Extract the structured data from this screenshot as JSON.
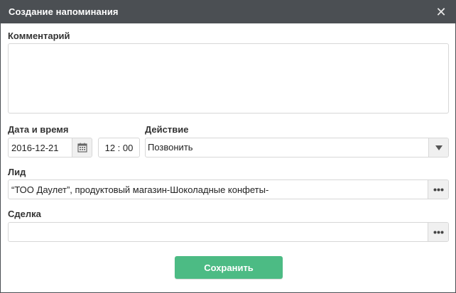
{
  "dialog": {
    "title": "Создание напоминания",
    "close_symbol": "✕"
  },
  "comment": {
    "label": "Комментарий",
    "value": ""
  },
  "datetime": {
    "label": "Дата и время",
    "date": "2016-12-21",
    "time": "12 : 00",
    "calendar_icon": "calendar-icon"
  },
  "action": {
    "label": "Действие",
    "selected": "Позвонить",
    "arrow_icon": "triangle-down-icon"
  },
  "lead": {
    "label": "Лид",
    "value": "“ТОО Даулет”, продуктовый магазин-Шоколадные конфеты-",
    "button_icon": "ellipsis-icon"
  },
  "deal": {
    "label": "Сделка",
    "value": "",
    "button_icon": "ellipsis-icon"
  },
  "save_button": {
    "label": "Сохранить",
    "color": "#4cbb84"
  },
  "colors": {
    "titlebar": "#4b4f53",
    "border": "#d7d7d7"
  }
}
